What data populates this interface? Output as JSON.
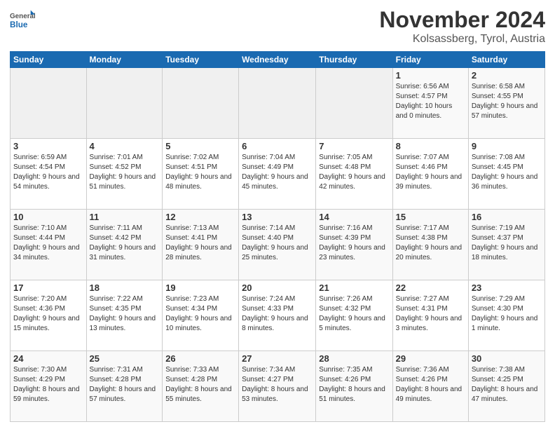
{
  "logo": {
    "general": "General",
    "blue": "Blue"
  },
  "header": {
    "month": "November 2024",
    "location": "Kolsassberg, Tyrol, Austria"
  },
  "weekdays": [
    "Sunday",
    "Monday",
    "Tuesday",
    "Wednesday",
    "Thursday",
    "Friday",
    "Saturday"
  ],
  "weeks": [
    [
      {
        "day": "",
        "info": ""
      },
      {
        "day": "",
        "info": ""
      },
      {
        "day": "",
        "info": ""
      },
      {
        "day": "",
        "info": ""
      },
      {
        "day": "",
        "info": ""
      },
      {
        "day": "1",
        "info": "Sunrise: 6:56 AM\nSunset: 4:57 PM\nDaylight: 10 hours and 0 minutes."
      },
      {
        "day": "2",
        "info": "Sunrise: 6:58 AM\nSunset: 4:55 PM\nDaylight: 9 hours and 57 minutes."
      }
    ],
    [
      {
        "day": "3",
        "info": "Sunrise: 6:59 AM\nSunset: 4:54 PM\nDaylight: 9 hours and 54 minutes."
      },
      {
        "day": "4",
        "info": "Sunrise: 7:01 AM\nSunset: 4:52 PM\nDaylight: 9 hours and 51 minutes."
      },
      {
        "day": "5",
        "info": "Sunrise: 7:02 AM\nSunset: 4:51 PM\nDaylight: 9 hours and 48 minutes."
      },
      {
        "day": "6",
        "info": "Sunrise: 7:04 AM\nSunset: 4:49 PM\nDaylight: 9 hours and 45 minutes."
      },
      {
        "day": "7",
        "info": "Sunrise: 7:05 AM\nSunset: 4:48 PM\nDaylight: 9 hours and 42 minutes."
      },
      {
        "day": "8",
        "info": "Sunrise: 7:07 AM\nSunset: 4:46 PM\nDaylight: 9 hours and 39 minutes."
      },
      {
        "day": "9",
        "info": "Sunrise: 7:08 AM\nSunset: 4:45 PM\nDaylight: 9 hours and 36 minutes."
      }
    ],
    [
      {
        "day": "10",
        "info": "Sunrise: 7:10 AM\nSunset: 4:44 PM\nDaylight: 9 hours and 34 minutes."
      },
      {
        "day": "11",
        "info": "Sunrise: 7:11 AM\nSunset: 4:42 PM\nDaylight: 9 hours and 31 minutes."
      },
      {
        "day": "12",
        "info": "Sunrise: 7:13 AM\nSunset: 4:41 PM\nDaylight: 9 hours and 28 minutes."
      },
      {
        "day": "13",
        "info": "Sunrise: 7:14 AM\nSunset: 4:40 PM\nDaylight: 9 hours and 25 minutes."
      },
      {
        "day": "14",
        "info": "Sunrise: 7:16 AM\nSunset: 4:39 PM\nDaylight: 9 hours and 23 minutes."
      },
      {
        "day": "15",
        "info": "Sunrise: 7:17 AM\nSunset: 4:38 PM\nDaylight: 9 hours and 20 minutes."
      },
      {
        "day": "16",
        "info": "Sunrise: 7:19 AM\nSunset: 4:37 PM\nDaylight: 9 hours and 18 minutes."
      }
    ],
    [
      {
        "day": "17",
        "info": "Sunrise: 7:20 AM\nSunset: 4:36 PM\nDaylight: 9 hours and 15 minutes."
      },
      {
        "day": "18",
        "info": "Sunrise: 7:22 AM\nSunset: 4:35 PM\nDaylight: 9 hours and 13 minutes."
      },
      {
        "day": "19",
        "info": "Sunrise: 7:23 AM\nSunset: 4:34 PM\nDaylight: 9 hours and 10 minutes."
      },
      {
        "day": "20",
        "info": "Sunrise: 7:24 AM\nSunset: 4:33 PM\nDaylight: 9 hours and 8 minutes."
      },
      {
        "day": "21",
        "info": "Sunrise: 7:26 AM\nSunset: 4:32 PM\nDaylight: 9 hours and 5 minutes."
      },
      {
        "day": "22",
        "info": "Sunrise: 7:27 AM\nSunset: 4:31 PM\nDaylight: 9 hours and 3 minutes."
      },
      {
        "day": "23",
        "info": "Sunrise: 7:29 AM\nSunset: 4:30 PM\nDaylight: 9 hours and 1 minute."
      }
    ],
    [
      {
        "day": "24",
        "info": "Sunrise: 7:30 AM\nSunset: 4:29 PM\nDaylight: 8 hours and 59 minutes."
      },
      {
        "day": "25",
        "info": "Sunrise: 7:31 AM\nSunset: 4:28 PM\nDaylight: 8 hours and 57 minutes."
      },
      {
        "day": "26",
        "info": "Sunrise: 7:33 AM\nSunset: 4:28 PM\nDaylight: 8 hours and 55 minutes."
      },
      {
        "day": "27",
        "info": "Sunrise: 7:34 AM\nSunset: 4:27 PM\nDaylight: 8 hours and 53 minutes."
      },
      {
        "day": "28",
        "info": "Sunrise: 7:35 AM\nSunset: 4:26 PM\nDaylight: 8 hours and 51 minutes."
      },
      {
        "day": "29",
        "info": "Sunrise: 7:36 AM\nSunset: 4:26 PM\nDaylight: 8 hours and 49 minutes."
      },
      {
        "day": "30",
        "info": "Sunrise: 7:38 AM\nSunset: 4:25 PM\nDaylight: 8 hours and 47 minutes."
      }
    ]
  ]
}
